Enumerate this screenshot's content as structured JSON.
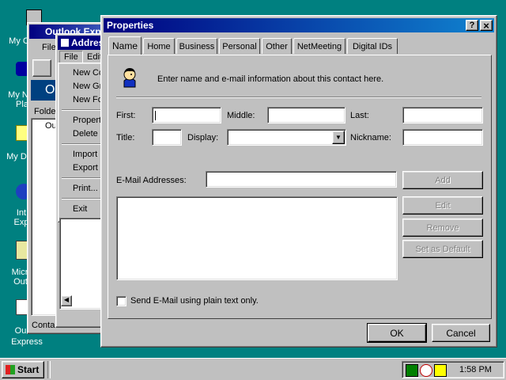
{
  "desktop": {
    "icons": [
      {
        "label": "My C"
      },
      {
        "label": "My N"
      },
      {
        "label": "Pla"
      },
      {
        "label": "My Do"
      },
      {
        "label": "Int"
      },
      {
        "label": "Exp"
      },
      {
        "label": "Micr"
      },
      {
        "label": "Out"
      },
      {
        "label": "Ou"
      },
      {
        "label": "Express"
      }
    ]
  },
  "outlook": {
    "title": "Outlook Exp",
    "menu_file": "File",
    "folder_tab": "Folde",
    "tree_item": "Ou",
    "status": "Contai",
    "big_letter": "O"
  },
  "address_book": {
    "title": "Addres",
    "menu": [
      "File",
      "Edit"
    ],
    "file_menu_items": [
      "New Co",
      "New Gr",
      "New Fo",
      "Propert",
      "Delete",
      "Import",
      "Export",
      "Print...",
      "Exit"
    ]
  },
  "dialog": {
    "title": "Properties",
    "help_btn": "?",
    "close_btn": "×",
    "tabs": [
      "Name",
      "Home",
      "Business",
      "Personal",
      "Other",
      "NetMeeting",
      "Digital IDs"
    ],
    "intro": "Enter name and e-mail information about this contact here.",
    "fields": {
      "first_label": "First:",
      "middle_label": "Middle:",
      "last_label": "Last:",
      "title_label": "Title:",
      "display_label": "Display:",
      "nickname_label": "Nickname:",
      "first_value": "",
      "middle_value": "",
      "last_value": "",
      "title_value": "",
      "display_value": "",
      "nickname_value": ""
    },
    "email_label": "E-Mail Addresses:",
    "email_value": "",
    "buttons": {
      "add": "Add",
      "edit": "Edit",
      "remove": "Remove",
      "set_default": "Set as Default",
      "ok": "OK",
      "cancel": "Cancel"
    },
    "plain_text_checkbox": "Send E-Mail using plain text only.",
    "plain_text_checked": false
  },
  "taskbar": {
    "start": "Start",
    "clock": "1:58 PM"
  },
  "colors": {
    "desktop": "#008080",
    "titlebar_active": "#000080",
    "face": "#c0c0c0"
  }
}
